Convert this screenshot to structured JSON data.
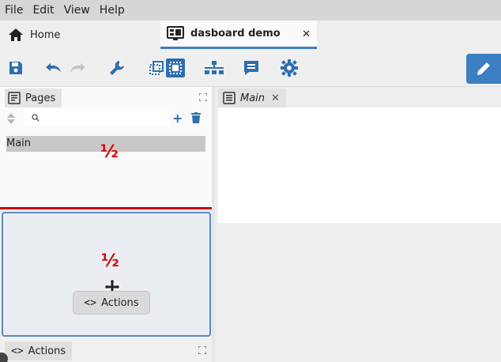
{
  "menu": [
    "File",
    "Edit",
    "View",
    "Help"
  ],
  "tabs": {
    "home_label": "Home",
    "demo_label": "dasboard demo",
    "close_glyph": "✕"
  },
  "toolbar": {
    "icons": [
      "save-icon",
      "undo-icon",
      "redo-icon",
      "wrench-icon",
      "select-icon",
      "frame-select-icon",
      "hierarchy-icon",
      "comment-icon",
      "gear-icon",
      "pencil-icon"
    ],
    "accent_color": "#3d7fc1"
  },
  "pages_panel": {
    "tab_label": "Pages",
    "search_value": "",
    "add_glyph": "+",
    "items": [
      "Main"
    ]
  },
  "split_marker": "½",
  "actions_panel": {
    "floating_label": "Actions",
    "tab_label": "Actions"
  },
  "editor": {
    "tab_label": "Main",
    "close_glyph": "✕"
  }
}
